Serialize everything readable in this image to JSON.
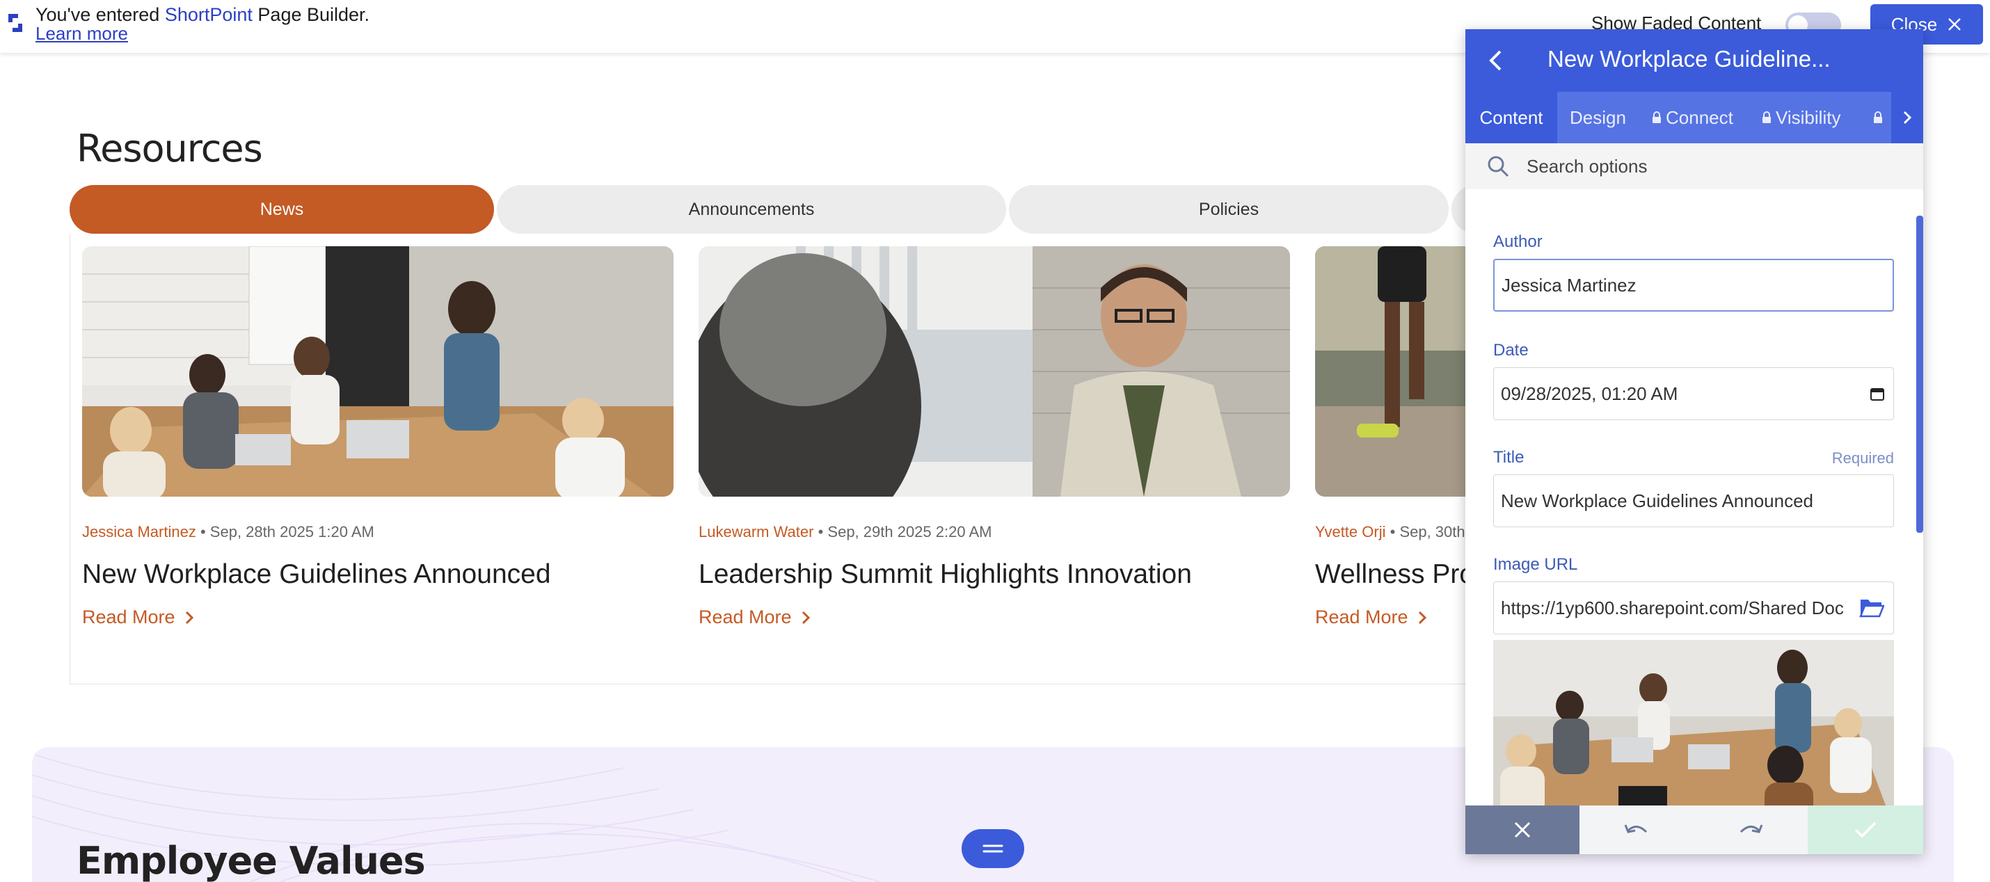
{
  "topbar": {
    "message_prefix": "You've entered",
    "brand": "ShortPoint",
    "message_suffix": "Page Builder.",
    "learn_more": "Learn more",
    "faded_label": "Show Faded Content",
    "faded_enabled": false,
    "close_label": "Close"
  },
  "resources": {
    "title": "Resources",
    "tabs": [
      {
        "label": "News",
        "active": true
      },
      {
        "label": "Announcements",
        "active": false
      },
      {
        "label": "Policies",
        "active": false
      }
    ],
    "cards": [
      {
        "author": "Jessica Martinez",
        "date": "Sep, 28th 2025 1:20 AM",
        "title": "New Workplace Guidelines Announced",
        "link": "Read More"
      },
      {
        "author": "Lukewarm Water",
        "date": "Sep, 29th 2025 2:20 AM",
        "title": "Leadership Summit Highlights Innovation",
        "link": "Read More"
      },
      {
        "author": "Yvette Orji",
        "date": "Sep, 30th",
        "title": "Wellness Prog",
        "link": "Read More"
      }
    ]
  },
  "values": {
    "title": "Employee Values"
  },
  "panel": {
    "title": "New Workplace Guideline...",
    "tabs": [
      {
        "label": "Content",
        "locked": false,
        "active": true
      },
      {
        "label": "Design",
        "locked": false,
        "active": false
      },
      {
        "label": "Connect",
        "locked": true,
        "active": false
      },
      {
        "label": "Visibility",
        "locked": true,
        "active": false
      }
    ],
    "search_placeholder": "Search options",
    "fields": {
      "author_label": "Author",
      "author_value": "Jessica Martinez",
      "date_label": "Date",
      "date_value": "09/28/2025, 01:20 AM",
      "title_label": "Title",
      "title_required": "Required",
      "title_value": "New Workplace Guidelines Announced",
      "image_label": "Image URL",
      "image_value": "https://1yp600.sharepoint.com/Shared Doc"
    }
  },
  "colors": {
    "accent": "#3b5bdb",
    "brand_orange": "#c45a24",
    "values_bg": "#f3eefc"
  },
  "icons": {
    "shortpoint_logo": "shortpoint-logo-icon",
    "close": "close-icon",
    "back": "chevron-left-icon",
    "lock": "lock-icon",
    "next": "chevron-right-icon",
    "search": "search-icon",
    "calendar": "calendar-icon",
    "folder": "folder-open-icon",
    "undo": "undo-icon",
    "redo": "redo-icon",
    "check": "check-icon",
    "menu": "menu-icon"
  }
}
